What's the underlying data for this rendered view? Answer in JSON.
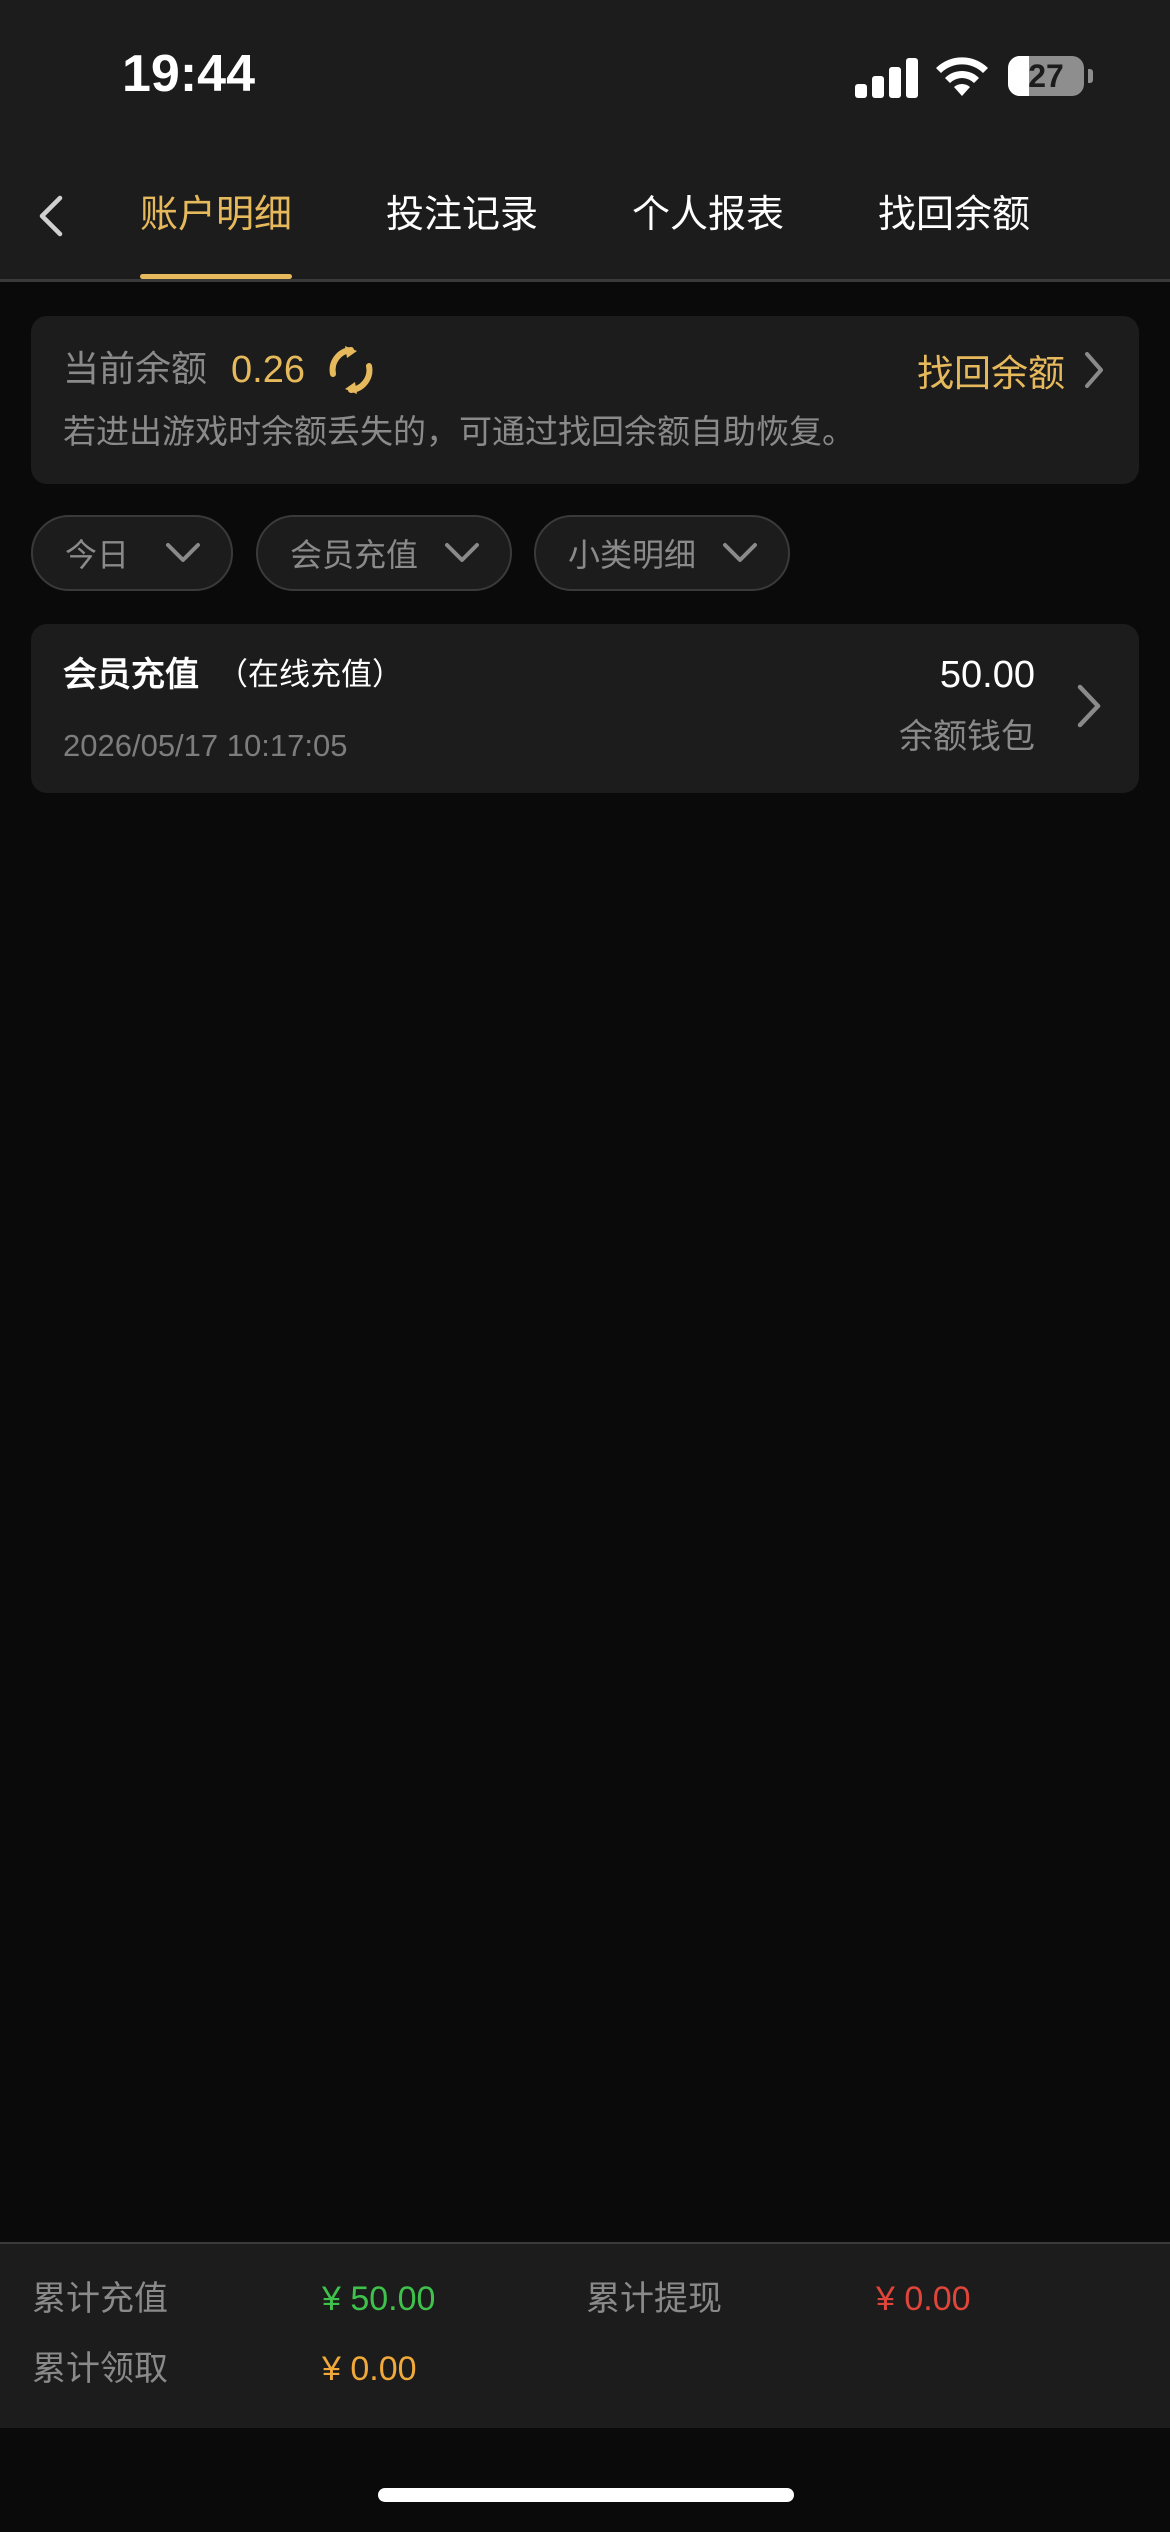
{
  "status_bar": {
    "time": "19:44",
    "battery": "27"
  },
  "nav": {
    "tabs": [
      {
        "label": "账户明细",
        "active": true
      },
      {
        "label": "投注记录",
        "active": false
      },
      {
        "label": "个人报表",
        "active": false
      },
      {
        "label": "找回余额",
        "active": false
      }
    ]
  },
  "balance": {
    "label": "当前余额",
    "value": "0.26",
    "recover_label": "找回余额",
    "tip": "若进出游戏时余额丢失的，可通过找回余额自助恢复。"
  },
  "filters": [
    {
      "label": "今日"
    },
    {
      "label": "会员充值"
    },
    {
      "label": "小类明细"
    }
  ],
  "records": [
    {
      "title": "会员充值",
      "subtitle": "（在线充值）",
      "time": "2026/05/17 10:17:05",
      "amount": "50.00",
      "wallet": "余额钱包"
    }
  ],
  "footer": {
    "total_recharge_label": "累计充值",
    "total_recharge_value": "¥ 50.00",
    "total_withdraw_label": "累计提现",
    "total_withdraw_value": "¥ 0.00",
    "total_claim_label": "累计领取",
    "total_claim_value": "¥ 0.00"
  },
  "colors": {
    "accent": "#e6b95c",
    "recharge_green": "#3fc24b",
    "withdraw_red": "#e0453a",
    "claim_orange": "#f0a93a"
  },
  "icons": {
    "back": "chevron-left-icon",
    "refresh": "refresh-icon",
    "chevron_right": "chevron-right-icon",
    "dropdown": "chevron-down-icon"
  }
}
